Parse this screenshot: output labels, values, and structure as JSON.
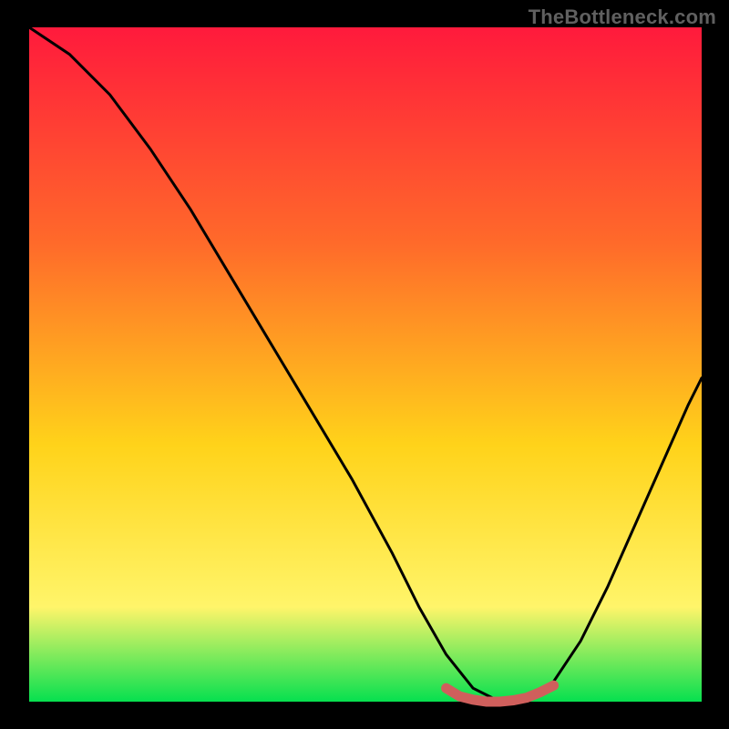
{
  "watermark": "TheBottleneck.com",
  "colors": {
    "frame": "#000000",
    "gradient_top": "#ff1a3c",
    "gradient_mid1": "#ff6a2a",
    "gradient_mid2": "#ffd31a",
    "gradient_mid3": "#fff56a",
    "gradient_bottom": "#06e04f",
    "curve": "#000000",
    "marker": "#cf5f5c"
  },
  "chart_data": {
    "type": "line",
    "title": "",
    "xlabel": "",
    "ylabel": "",
    "xlim": [
      0,
      100
    ],
    "ylim": [
      0,
      100
    ],
    "series": [
      {
        "name": "bottleneck-curve",
        "x": [
          0,
          6,
          12,
          18,
          24,
          30,
          36,
          42,
          48,
          54,
          58,
          62,
          66,
          70,
          74,
          78,
          82,
          86,
          90,
          94,
          98,
          100
        ],
        "y": [
          100,
          96,
          90,
          82,
          73,
          63,
          53,
          43,
          33,
          22,
          14,
          7,
          2,
          0,
          0,
          3,
          9,
          17,
          26,
          35,
          44,
          48
        ]
      }
    ],
    "optimal_segment": {
      "name": "optimal-range-marker",
      "x": [
        62,
        64,
        66,
        68,
        70,
        72,
        74,
        76,
        78
      ],
      "y": [
        2.0,
        0.8,
        0.3,
        0.0,
        0.0,
        0.2,
        0.6,
        1.4,
        2.4
      ]
    }
  }
}
